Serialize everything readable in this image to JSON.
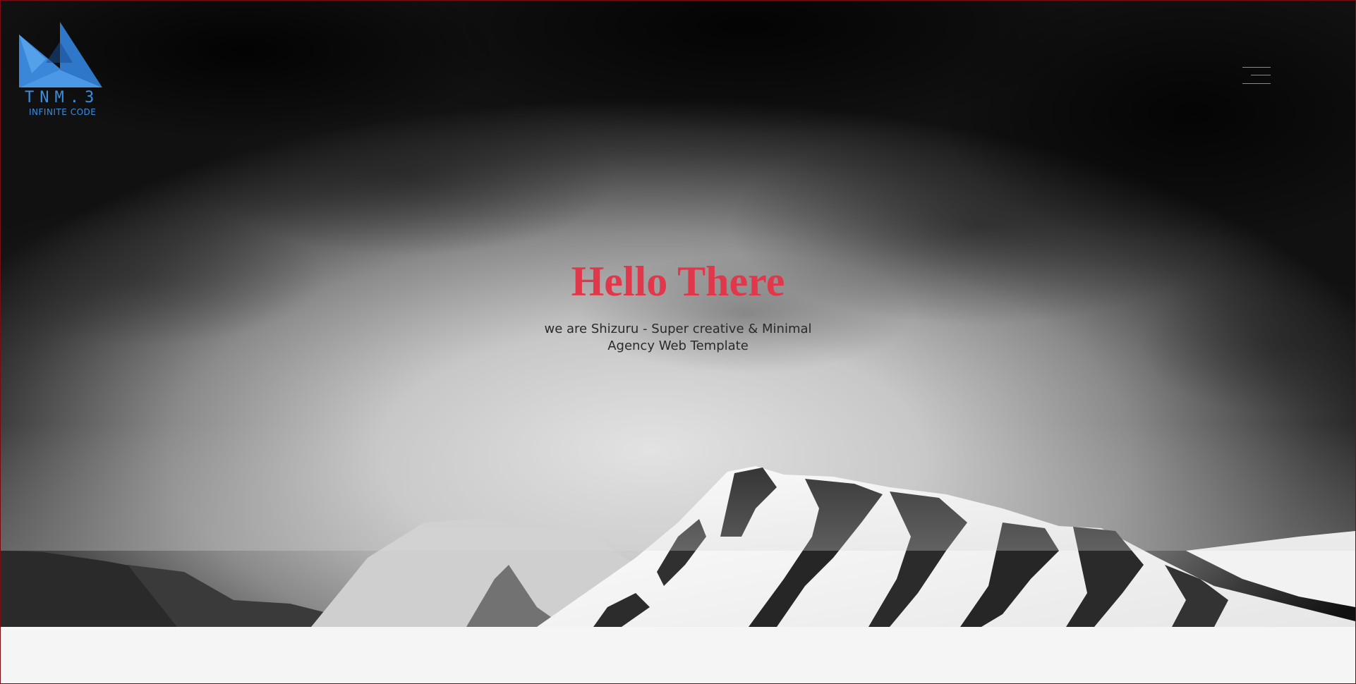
{
  "header": {
    "logo": {
      "icon": "triangle-logo-icon",
      "brand_line_1": "TNM.3",
      "brand_line_2": "INFINITE CODE",
      "color": "#3b8fe0"
    },
    "menu_icon": "hamburger-menu-icon"
  },
  "hero": {
    "title": "Hello There",
    "subtitle_line_1": "we are Shizuru - Super creative & Minimal",
    "subtitle_line_2": "Agency Web Template",
    "title_color": "#e0384a",
    "background": "snowy-mountain-clouds-image"
  },
  "colors": {
    "frame_border": "#7a0b14",
    "page_background": "#f5f5f5"
  }
}
